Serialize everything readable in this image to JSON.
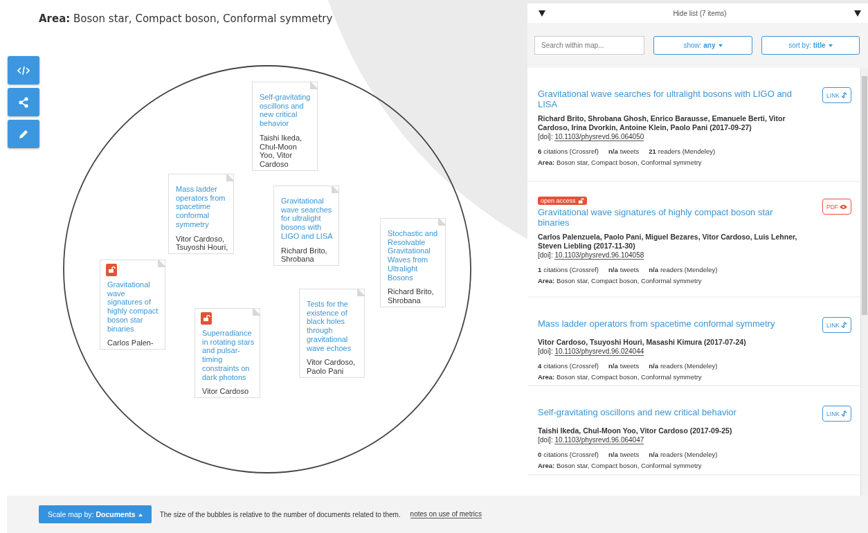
{
  "area": {
    "label": "Area:",
    "value": "Boson star, Compact boson, Conformal symmetry"
  },
  "map": {
    "papers": [
      {
        "title": "Self-gravitating oscillons and new critical behavior",
        "authors": "Taishi Ikeda, Chul-Moon Yoo, Vitor Cardoso",
        "open_access": false
      },
      {
        "title": "Mass ladder operators from spacetime conformal symmetry",
        "authors": "Vitor Cardoso, Tsuyoshi Houri,",
        "open_access": false
      },
      {
        "title": "Gravitational wave searches for ultralight bosons with LIGO and LISA",
        "authors": "Richard Brito, Shrobana",
        "open_access": false
      },
      {
        "title": "Stochastic and Resolvable Gravitational Waves from Ultralight Bosons",
        "authors": "Richard Brito, Shrobana",
        "open_access": false
      },
      {
        "title": "Gravitational wave signatures of highly compact boson star binaries",
        "authors": "Carlos Palen-",
        "open_access": true
      },
      {
        "title": "Superradiance in rotating stars and pulsar-timing constraints on dark photons",
        "authors": "Vitor Cardoso",
        "open_access": true
      },
      {
        "title": "Tests for the existence of black holes through gravitational wave echoes",
        "authors": "Vitor Cardoso, Paolo Pani",
        "open_access": false
      }
    ]
  },
  "list": {
    "toggle": "Hide list (7 items)",
    "search": {
      "placeholder": "Search within map..."
    },
    "filter": {
      "label": "show:",
      "value": "any"
    },
    "sort": {
      "label": "sort by:",
      "value": "title"
    },
    "items": [
      {
        "open_access": false,
        "title": "Gravitational wave searches for ultralight bosons with LIGO and LISA",
        "authors": "Richard Brito, Shrobana Ghosh, Enrico Barausse, Emanuele Berti, Vitor Cardoso, Irina Dvorkin, Antoine Klein, Paolo Pani (2017-09-27)",
        "doi_label": "[doi]:",
        "doi": "10.1103/physrevd.96.064050",
        "metrics": [
          {
            "count": "6",
            "unit": "citations (Crossref)"
          },
          {
            "count": "n/a",
            "unit": "tweets"
          },
          {
            "count": "21",
            "unit": "readers (Mendeley)"
          }
        ],
        "area_label": "Area:",
        "area": "Boson star, Compact boson, Conformal symmetry",
        "button": {
          "kind": "link",
          "label": "LINK"
        }
      },
      {
        "open_access": true,
        "badge": "open access",
        "title": "Gravitational wave signatures of highly compact boson star binaries",
        "authors": "Carlos Palenzuela, Paolo Pani, Miguel Bezares, Vitor Cardoso, Luis Lehner, Steven Liebling (2017-11-30)",
        "doi_label": "[doi]:",
        "doi": "10.1103/physrevd.96.104058",
        "metrics": [
          {
            "count": "1",
            "unit": "citations (Crossref)"
          },
          {
            "count": "n/a",
            "unit": "tweets"
          },
          {
            "count": "n/a",
            "unit": "readers (Mendeley)"
          }
        ],
        "area_label": "Area:",
        "area": "Boson star, Compact boson, Conformal symmetry",
        "button": {
          "kind": "pdf",
          "label": "PDF"
        }
      },
      {
        "open_access": false,
        "title": "Mass ladder operators from spacetime conformal symmetry",
        "authors": "Vitor Cardoso, Tsuyoshi Houri, Masashi Kimura (2017-07-24)",
        "doi_label": "[doi]:",
        "doi": "10.1103/physrevd.96.024044",
        "metrics": [
          {
            "count": "4",
            "unit": "citations (Crossref)"
          },
          {
            "count": "n/a",
            "unit": "tweets"
          },
          {
            "count": "n/a",
            "unit": "readers (Mendeley)"
          }
        ],
        "area_label": "Area:",
        "area": "Boson star, Compact boson, Conformal symmetry",
        "button": {
          "kind": "link",
          "label": "LINK"
        }
      },
      {
        "open_access": false,
        "title": "Self-gravitating oscillons and new critical behavior",
        "authors": "Taishi Ikeda, Chul-Moon Yoo, Vitor Cardoso (2017-09-25)",
        "doi_label": "[doi]:",
        "doi": "10.1103/physrevd.96.064047",
        "metrics": [
          {
            "count": "0",
            "unit": "citations (Crossref)"
          },
          {
            "count": "n/a",
            "unit": "tweets"
          },
          {
            "count": "n/a",
            "unit": "readers (Mendeley)"
          }
        ],
        "area_label": "Area:",
        "area": "Boson star, Compact boson, Conformal symmetry",
        "button": {
          "kind": "link",
          "label": "LINK"
        }
      }
    ]
  },
  "footer": {
    "scale": {
      "label": "Scale map by:",
      "value": "Documents"
    },
    "note": "The size of the bubbles is relative to the number of documents related to them.",
    "link": "notes on use of metrics"
  }
}
